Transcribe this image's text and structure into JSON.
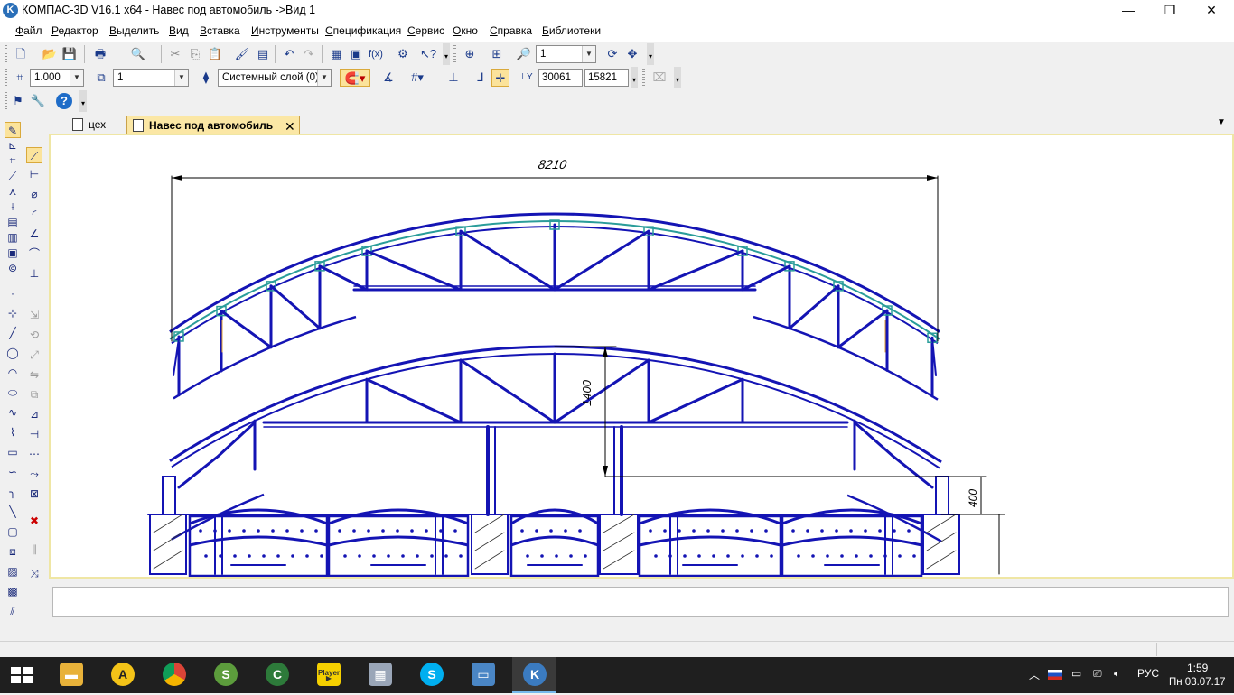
{
  "window": {
    "title": "КОМПАС-3D V16.1 x64 - Навес под автомобиль ->Вид 1",
    "app_icon": "kompas-logo-icon",
    "controls": {
      "minimize": "—",
      "restore": "❐",
      "close": "✕"
    }
  },
  "menu": [
    {
      "label": "Файл",
      "key": "Ф"
    },
    {
      "label": "Редактор",
      "key": "Р"
    },
    {
      "label": "Выделить",
      "key": "В"
    },
    {
      "label": "Вид",
      "key": "В"
    },
    {
      "label": "Вставка",
      "key": "В"
    },
    {
      "label": "Инструменты",
      "key": "И"
    },
    {
      "label": "Спецификация",
      "key": "С"
    },
    {
      "label": "Сервис",
      "key": "С"
    },
    {
      "label": "Окно",
      "key": "О"
    },
    {
      "label": "Справка",
      "key": "С"
    },
    {
      "label": "Библиотеки",
      "key": "Б"
    }
  ],
  "toolbar_standard": {
    "buttons": [
      "new-document-icon",
      "open-icon",
      "save-icon",
      "print-icon",
      "preview-icon",
      "cut-icon",
      "copy-icon",
      "paste-icon",
      "format-painter-icon",
      "properties-icon",
      "undo-icon",
      "redo-icon",
      "manager-icon",
      "library-icon",
      "formula-icon",
      "variables-icon",
      "help-pointer-icon",
      "zoom-window-icon",
      "zoom-all-icon",
      "zoom-in-icon",
      "refresh-icon",
      "pan-icon"
    ],
    "zoom_value": "1"
  },
  "toolbar_current_state": {
    "scale_value": "1.000",
    "view_value": "1",
    "layer_value": "Системный слой (0)",
    "coord_x": "30061",
    "coord_y": "15821",
    "y_label": "Y"
  },
  "toolbar_extra": {
    "buttons": [
      "attributes-icon",
      "tools-icon",
      "help-icon"
    ]
  },
  "tabs": [
    {
      "label": "цех",
      "active": false
    },
    {
      "label": "Навес под автомобиль",
      "active": true,
      "close": "✕"
    }
  ],
  "drawing": {
    "dim_width": "8210",
    "dim_height_upper": "1400",
    "dim_height_lower": "400",
    "line_color": "#1414b4",
    "highlight_color": "#2a9d9a",
    "dim_color": "#000000"
  },
  "left_panel": {
    "compact_icons": [
      "geometry-icon",
      "dimensions-icon",
      "symbols-icon",
      "edit-icon",
      "parametrization-icon",
      "measure-icon",
      "select-icon",
      "associative-views-icon",
      "spec-icon",
      "reports-icon",
      "insert-icon",
      "fragment-icon"
    ],
    "geometry_icons": [
      "point-icon",
      "auxiliary-line-icon",
      "segment-icon",
      "circle-icon",
      "arc-icon",
      "ellipse-icon",
      "spline-icon",
      "polyline-icon",
      "rectangle-icon",
      "polygon-icon",
      "hatch-icon",
      "fillet-icon",
      "chamfer-icon",
      "contour-icon",
      "bezier-icon",
      "offset-icon",
      "equidistant-icon",
      "collect-contour-icon"
    ]
  },
  "taskbar": {
    "apps": [
      "windows-start-icon",
      "file-explorer-icon",
      "archicad-icon",
      "chrome-icon",
      "sketchup-icon",
      "corel-icon",
      "media-player-icon",
      "calculator-icon",
      "skype-icon",
      "picture-viewer-icon",
      "kompas-icon"
    ],
    "player_label": "Player",
    "tray": [
      "chevron-up-icon",
      "russian-flag-icon",
      "network-icon",
      "display-icon",
      "volume-icon"
    ],
    "language": "РУС",
    "time": "1:59",
    "date": "Пн 03.07.17"
  }
}
